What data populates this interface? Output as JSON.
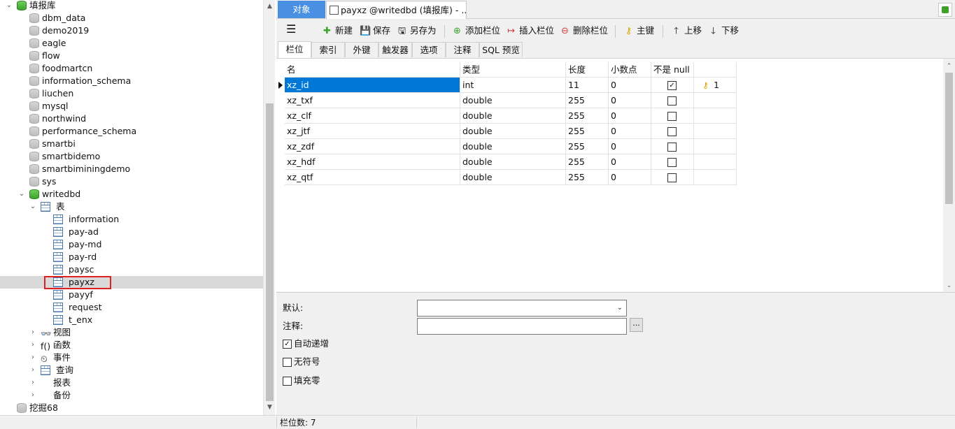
{
  "tree": {
    "items": [
      {
        "label": "填报库",
        "level": 0,
        "icon": "db-green-icon",
        "chev": "down"
      },
      {
        "label": "dbm_data",
        "level": 1,
        "icon": "db-icon"
      },
      {
        "label": "demo2019",
        "level": 1,
        "icon": "db-icon"
      },
      {
        "label": "eagle",
        "level": 1,
        "icon": "db-icon"
      },
      {
        "label": "flow",
        "level": 1,
        "icon": "db-icon"
      },
      {
        "label": "foodmartcn",
        "level": 1,
        "icon": "db-icon"
      },
      {
        "label": "information_schema",
        "level": 1,
        "icon": "db-icon"
      },
      {
        "label": "liuchen",
        "level": 1,
        "icon": "db-icon"
      },
      {
        "label": "mysql",
        "level": 1,
        "icon": "db-icon"
      },
      {
        "label": "northwind",
        "level": 1,
        "icon": "db-icon"
      },
      {
        "label": "performance_schema",
        "level": 1,
        "icon": "db-icon"
      },
      {
        "label": "smartbi",
        "level": 1,
        "icon": "db-icon"
      },
      {
        "label": "smartbidemo",
        "level": 1,
        "icon": "db-icon"
      },
      {
        "label": "smartbiminingdemo",
        "level": 1,
        "icon": "db-icon"
      },
      {
        "label": "sys",
        "level": 1,
        "icon": "db-icon"
      },
      {
        "label": "writedbd",
        "level": 1,
        "icon": "db-green-icon",
        "chev": "down"
      },
      {
        "label": "表",
        "level": 2,
        "icon": "table-icon",
        "chev": "down"
      },
      {
        "label": "information",
        "level": 3,
        "icon": "table-icon"
      },
      {
        "label": "pay-ad",
        "level": 3,
        "icon": "table-icon"
      },
      {
        "label": "pay-md",
        "level": 3,
        "icon": "table-icon"
      },
      {
        "label": "pay-rd",
        "level": 3,
        "icon": "table-icon"
      },
      {
        "label": "paysc",
        "level": 3,
        "icon": "table-icon"
      },
      {
        "label": "payxz",
        "level": 3,
        "icon": "table-icon",
        "selected": true
      },
      {
        "label": "payyf",
        "level": 3,
        "icon": "table-icon"
      },
      {
        "label": "request",
        "level": 3,
        "icon": "table-icon"
      },
      {
        "label": "t_enx",
        "level": 3,
        "icon": "table-icon"
      },
      {
        "label": "视图",
        "level": 2,
        "icon": "view-icon",
        "chev": "right"
      },
      {
        "label": "函数",
        "level": 2,
        "icon": "function-icon",
        "chev": "right"
      },
      {
        "label": "事件",
        "level": 2,
        "icon": "event-icon",
        "chev": "right"
      },
      {
        "label": "查询",
        "level": 2,
        "icon": "query-icon",
        "chev": "right"
      },
      {
        "label": "报表",
        "level": 2,
        "icon": "report-icon",
        "chev": "right"
      },
      {
        "label": "备份",
        "level": 2,
        "icon": "backup-icon",
        "chev": "right"
      },
      {
        "label": "挖掘68",
        "level": 0,
        "icon": "db-icon"
      }
    ]
  },
  "tabs": {
    "objects": "对象",
    "document": "payxz @writedbd (填报库) - ..."
  },
  "toolbar": {
    "menu": "☰",
    "new": "新建",
    "save": "保存",
    "save_as": "另存为",
    "add_col": "添加栏位",
    "insert_col": "插入栏位",
    "delete_col": "删除栏位",
    "primary_key": "主键",
    "move_up": "上移",
    "move_down": "下移"
  },
  "subtabs": [
    "栏位",
    "索引",
    "外键",
    "触发器",
    "选项",
    "注释",
    "SQL 预览"
  ],
  "grid": {
    "headers": [
      "名",
      "类型",
      "长度",
      "小数点",
      "不是 null",
      ""
    ],
    "rows": [
      {
        "name": "xz_id",
        "type": "int",
        "length": "11",
        "decimals": "0",
        "not_null": true,
        "key": "1"
      },
      {
        "name": "xz_txf",
        "type": "double",
        "length": "255",
        "decimals": "0",
        "not_null": false,
        "key": ""
      },
      {
        "name": "xz_clf",
        "type": "double",
        "length": "255",
        "decimals": "0",
        "not_null": false,
        "key": ""
      },
      {
        "name": "xz_jtf",
        "type": "double",
        "length": "255",
        "decimals": "0",
        "not_null": false,
        "key": ""
      },
      {
        "name": "xz_zdf",
        "type": "double",
        "length": "255",
        "decimals": "0",
        "not_null": false,
        "key": ""
      },
      {
        "name": "xz_hdf",
        "type": "double",
        "length": "255",
        "decimals": "0",
        "not_null": false,
        "key": ""
      },
      {
        "name": "xz_qtf",
        "type": "double",
        "length": "255",
        "decimals": "0",
        "not_null": false,
        "key": ""
      }
    ]
  },
  "props": {
    "default_label": "默认:",
    "default_value": "",
    "comment_label": "注释:",
    "comment_value": "",
    "browse": "...",
    "auto_increment": "自动递增",
    "unsigned": "无符号",
    "zerofill": "填充零",
    "auto_increment_checked": true,
    "unsigned_checked": false,
    "zerofill_checked": false
  },
  "status": {
    "column_count": "栏位数: 7"
  },
  "colors": {
    "accent": "#0078d7",
    "tab_active": "#4a90e2",
    "selection_outline": "#e02020"
  }
}
